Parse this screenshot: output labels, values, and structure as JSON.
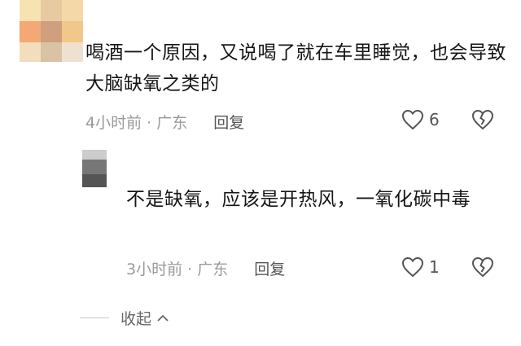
{
  "colors": {
    "avatar1": [
      "#f7e3b2",
      "#e8caa0",
      "#f4d8a8",
      "#f3a876",
      "#cf9f7e",
      "#f1c88a",
      "#f2ddbd",
      "#d9c3a4",
      "#efe1cf"
    ],
    "avatar2": [
      "#cccccc",
      "#777777",
      "#555555"
    ]
  },
  "comments": [
    {
      "text": "喝酒一个原因，又说喝了就在车里睡觉，也会导致大脑缺氧之类的",
      "time": "4小时前",
      "sep": "·",
      "location": "广东",
      "reply": "回复",
      "likes": "6",
      "like_icon": "heart-outline-icon",
      "dislike_icon": "broken-heart-icon"
    },
    {
      "text": "不是缺氧，应该是开热风，一氧化碳中毒",
      "time": "3小时前",
      "sep": "·",
      "location": "广东",
      "reply": "回复",
      "likes": "1",
      "like_icon": "heart-outline-icon",
      "dislike_icon": "broken-heart-icon"
    }
  ],
  "collapse": {
    "label": "收起",
    "icon": "chevron-up-icon"
  }
}
